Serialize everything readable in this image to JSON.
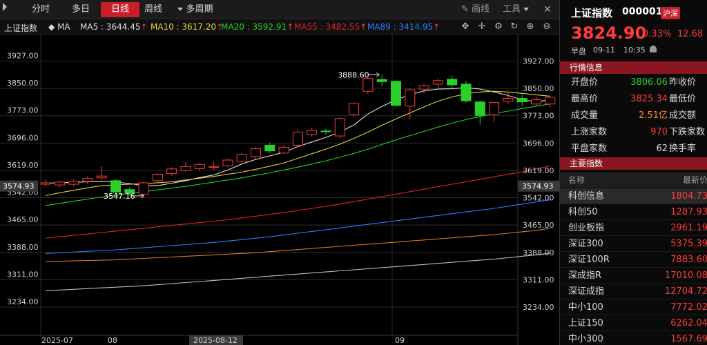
{
  "toolbar": {
    "tabs": [
      {
        "label": "分时",
        "active": false
      },
      {
        "label": "多日",
        "active": false
      },
      {
        "label": "日线",
        "active": true
      },
      {
        "label": "周线",
        "active": false
      },
      {
        "label": "多周期",
        "active": false
      }
    ],
    "draw_label": "画线",
    "tools_label": "工具"
  },
  "ma_bar": {
    "index_label": "上证指数",
    "ma_label": "MA",
    "ma5": "MA5 : 3644.45",
    "ma10": "MA10 : 3617.20",
    "ma20": "MA20 : 3592.91",
    "ma55": "MA55 : 3482.55",
    "ma89": "MA89 : 3414.95",
    "arrow": "↑"
  },
  "colors": {
    "up": "#ff3b3b",
    "down": "#2bd12b",
    "ma5": "#e0e0e0",
    "ma10": "#e6d43a",
    "ma20": "#22d422",
    "ma55": "#e02424",
    "ma89": "#2a7fff",
    "ma_orange": "#d9781f",
    "ma_grey": "#bdbdbd",
    "grid": "#2c2c2c",
    "accent": "#c8202b"
  },
  "chart_data": {
    "type": "candlestick",
    "y_ticks": [
      3927.0,
      3850.0,
      3773.0,
      3696.0,
      3619.0,
      3542.0,
      3465.0,
      3388.0,
      3311.0,
      3234.0
    ],
    "y_tick_labels": [
      "3927.00",
      "3850.00",
      "3773.00",
      "3696.00",
      "3619.00",
      "3542.00",
      "3465.00",
      "3388.00",
      "3311.00",
      "3234.00"
    ],
    "ylim": [
      3200,
      3980
    ],
    "current_value_label": "3574.93",
    "current_value": 3574.93,
    "x_labels": [
      {
        "label": "2025-07",
        "index": 0
      },
      {
        "label": "08",
        "index": 5
      },
      {
        "label": "2025-08-12",
        "index": 12
      },
      {
        "label": "09",
        "index": 26
      }
    ],
    "candles": [
      {
        "o": 3580,
        "h": 3592,
        "l": 3574,
        "c": 3584
      },
      {
        "o": 3578,
        "h": 3590,
        "l": 3570,
        "c": 3586
      },
      {
        "o": 3580,
        "h": 3594,
        "l": 3574,
        "c": 3588
      },
      {
        "o": 3588,
        "h": 3602,
        "l": 3580,
        "c": 3596
      },
      {
        "o": 3598,
        "h": 3630,
        "l": 3592,
        "c": 3603
      },
      {
        "o": 3590,
        "h": 3594,
        "l": 3552,
        "c": 3558
      },
      {
        "o": 3565,
        "h": 3572,
        "l": 3548,
        "c": 3555
      },
      {
        "o": 3552,
        "h": 3588,
        "l": 3547.16,
        "c": 3584
      },
      {
        "o": 3590,
        "h": 3612,
        "l": 3586,
        "c": 3608
      },
      {
        "o": 3610,
        "h": 3628,
        "l": 3604,
        "c": 3623
      },
      {
        "o": 3618,
        "h": 3642,
        "l": 3614,
        "c": 3630
      },
      {
        "o": 3624,
        "h": 3640,
        "l": 3618,
        "c": 3636
      },
      {
        "o": 3628,
        "h": 3644,
        "l": 3620,
        "c": 3630
      },
      {
        "o": 3632,
        "h": 3652,
        "l": 3628,
        "c": 3648
      },
      {
        "o": 3645,
        "h": 3668,
        "l": 3640,
        "c": 3664
      },
      {
        "o": 3658,
        "h": 3685,
        "l": 3652,
        "c": 3680
      },
      {
        "o": 3690,
        "h": 3697,
        "l": 3668,
        "c": 3674
      },
      {
        "o": 3668,
        "h": 3690,
        "l": 3664,
        "c": 3684
      },
      {
        "o": 3690,
        "h": 3735,
        "l": 3686,
        "c": 3727
      },
      {
        "o": 3720,
        "h": 3740,
        "l": 3714,
        "c": 3732
      },
      {
        "o": 3730,
        "h": 3736,
        "l": 3720,
        "c": 3728
      },
      {
        "o": 3716,
        "h": 3770,
        "l": 3710,
        "c": 3765
      },
      {
        "o": 3776,
        "h": 3810,
        "l": 3770,
        "c": 3808
      },
      {
        "o": 3842,
        "h": 3880,
        "l": 3834,
        "c": 3878
      },
      {
        "o": 3875,
        "h": 3888.6,
        "l": 3856,
        "c": 3869
      },
      {
        "o": 3870,
        "h": 3872,
        "l": 3800,
        "c": 3802
      },
      {
        "o": 3800,
        "h": 3850,
        "l": 3764,
        "c": 3846
      },
      {
        "o": 3848,
        "h": 3862,
        "l": 3836,
        "c": 3858
      },
      {
        "o": 3862,
        "h": 3878,
        "l": 3852,
        "c": 3872
      },
      {
        "o": 3876,
        "h": 3886,
        "l": 3852,
        "c": 3860
      },
      {
        "o": 3862,
        "h": 3870,
        "l": 3810,
        "c": 3815
      },
      {
        "o": 3812,
        "h": 3816,
        "l": 3748,
        "c": 3774
      },
      {
        "o": 3776,
        "h": 3812,
        "l": 3756,
        "c": 3810
      },
      {
        "o": 3814,
        "h": 3838,
        "l": 3806,
        "c": 3822
      },
      {
        "o": 3822,
        "h": 3832,
        "l": 3800,
        "c": 3812
      },
      {
        "o": 3806,
        "h": 3826,
        "l": 3800,
        "c": 3818
      },
      {
        "o": 3806,
        "h": 3825.34,
        "l": 3796,
        "c": 3824.9
      }
    ],
    "annotations": [
      {
        "label": "3888.60",
        "index": 24,
        "value": 3888.6
      },
      {
        "label": "3547.16",
        "index": 7,
        "value": 3547.16
      }
    ],
    "series": [
      {
        "key": "ma5",
        "values": [
          3583,
          3584,
          3585,
          3587,
          3588,
          3586,
          3582,
          3576,
          3576,
          3583,
          3590,
          3599,
          3606,
          3620,
          3637,
          3650,
          3660,
          3670,
          3686,
          3699,
          3712,
          3727,
          3747,
          3778,
          3799,
          3818,
          3832,
          3843,
          3848,
          3849,
          3852,
          3848,
          3840,
          3830,
          3818,
          3812,
          3818
        ]
      },
      {
        "key": "ma10",
        "values": [
          3548,
          3556,
          3563,
          3570,
          3576,
          3578,
          3580,
          3582,
          3584,
          3587,
          3592,
          3597,
          3602,
          3608,
          3614,
          3622,
          3631,
          3640,
          3653,
          3666,
          3679,
          3693,
          3709,
          3727,
          3746,
          3764,
          3781,
          3798,
          3814,
          3826,
          3835,
          3840,
          3842,
          3840,
          3836,
          3832,
          3828
        ]
      },
      {
        "key": "ma20",
        "values": [
          3520,
          3526,
          3532,
          3538,
          3544,
          3549,
          3554,
          3559,
          3564,
          3569,
          3574,
          3580,
          3586,
          3592,
          3598,
          3605,
          3612,
          3620,
          3628,
          3637,
          3646,
          3656,
          3667,
          3679,
          3692,
          3705,
          3717,
          3729,
          3741,
          3752,
          3762,
          3771,
          3779,
          3786,
          3793,
          3800,
          3806
        ]
      },
      {
        "key": "ma55",
        "values": [
          3428,
          3432,
          3436,
          3440,
          3444,
          3448,
          3452,
          3456,
          3460,
          3464,
          3468,
          3472,
          3476,
          3480,
          3485,
          3490,
          3495,
          3500,
          3506,
          3512,
          3518,
          3524,
          3531,
          3538,
          3545,
          3552,
          3559,
          3566,
          3573,
          3580,
          3587,
          3594,
          3601,
          3608,
          3615,
          3623,
          3632
        ]
      },
      {
        "key": "ma89",
        "values": [
          3385,
          3387,
          3389,
          3391,
          3393,
          3395,
          3398,
          3401,
          3404,
          3407,
          3410,
          3413,
          3416,
          3420,
          3424,
          3428,
          3432,
          3437,
          3442,
          3447,
          3452,
          3457,
          3462,
          3467,
          3472,
          3477,
          3482,
          3487,
          3492,
          3497,
          3502,
          3507,
          3512,
          3518,
          3524,
          3530,
          3536
        ]
      },
      {
        "key": "ma_orange",
        "values": [
          3362,
          3363,
          3364,
          3365,
          3366,
          3367,
          3369,
          3371,
          3373,
          3375,
          3377,
          3379,
          3381,
          3383,
          3385,
          3387,
          3390,
          3393,
          3396,
          3399,
          3402,
          3405,
          3408,
          3411,
          3414,
          3417,
          3420,
          3423,
          3426,
          3429,
          3432,
          3435,
          3438,
          3442,
          3446,
          3450,
          3456
        ]
      },
      {
        "key": "ma_grey",
        "values": [
          3280,
          3282,
          3284,
          3286,
          3288,
          3290,
          3292,
          3294,
          3297,
          3300,
          3303,
          3306,
          3309,
          3312,
          3315,
          3318,
          3321,
          3324,
          3327,
          3330,
          3333,
          3336,
          3339,
          3342,
          3345,
          3348,
          3351,
          3354,
          3357,
          3360,
          3363,
          3366,
          3369,
          3373,
          3377,
          3381,
          3386
        ]
      }
    ]
  },
  "quote": {
    "title": "上证指数",
    "code": "000001",
    "badge": "沪深",
    "price": "3824.90",
    "pct": "0.33%",
    "change": "12.68",
    "session": "早盘",
    "date": "09-11",
    "time": "10:35"
  },
  "market_info": {
    "header": "行情信息",
    "rows": [
      {
        "label": "开盘价",
        "value": "3806.06",
        "color": "green",
        "label2": "昨收价"
      },
      {
        "label": "最高价",
        "value": "3825.34",
        "color": "red",
        "label2": "最低价"
      },
      {
        "label": "成交量",
        "value": "2.51亿",
        "color": "amber",
        "label2": "成交额"
      },
      {
        "label": "上涨家数",
        "value": "970",
        "color": "red",
        "label2": "下跌家数"
      },
      {
        "label": "平盘家数",
        "value": "62",
        "color": "white",
        "label2": "换手率"
      }
    ]
  },
  "indices": {
    "header": "主要指数",
    "col_name": "名称",
    "col_price": "最新价",
    "rows": [
      {
        "name": "科创信息",
        "price": "1804.73"
      },
      {
        "name": "科创50",
        "price": "1287.93"
      },
      {
        "name": "创业板指",
        "price": "2961.19"
      },
      {
        "name": "深证300",
        "price": "5375.39"
      },
      {
        "name": "深证100R",
        "price": "7883.60"
      },
      {
        "name": "深成指R",
        "price": "17010.08"
      },
      {
        "name": "深证成指",
        "price": "12704.72"
      },
      {
        "name": "中小100",
        "price": "7772.02"
      },
      {
        "name": "上证150",
        "price": "6262.04"
      },
      {
        "name": "中小300",
        "price": "1567.69"
      }
    ]
  }
}
